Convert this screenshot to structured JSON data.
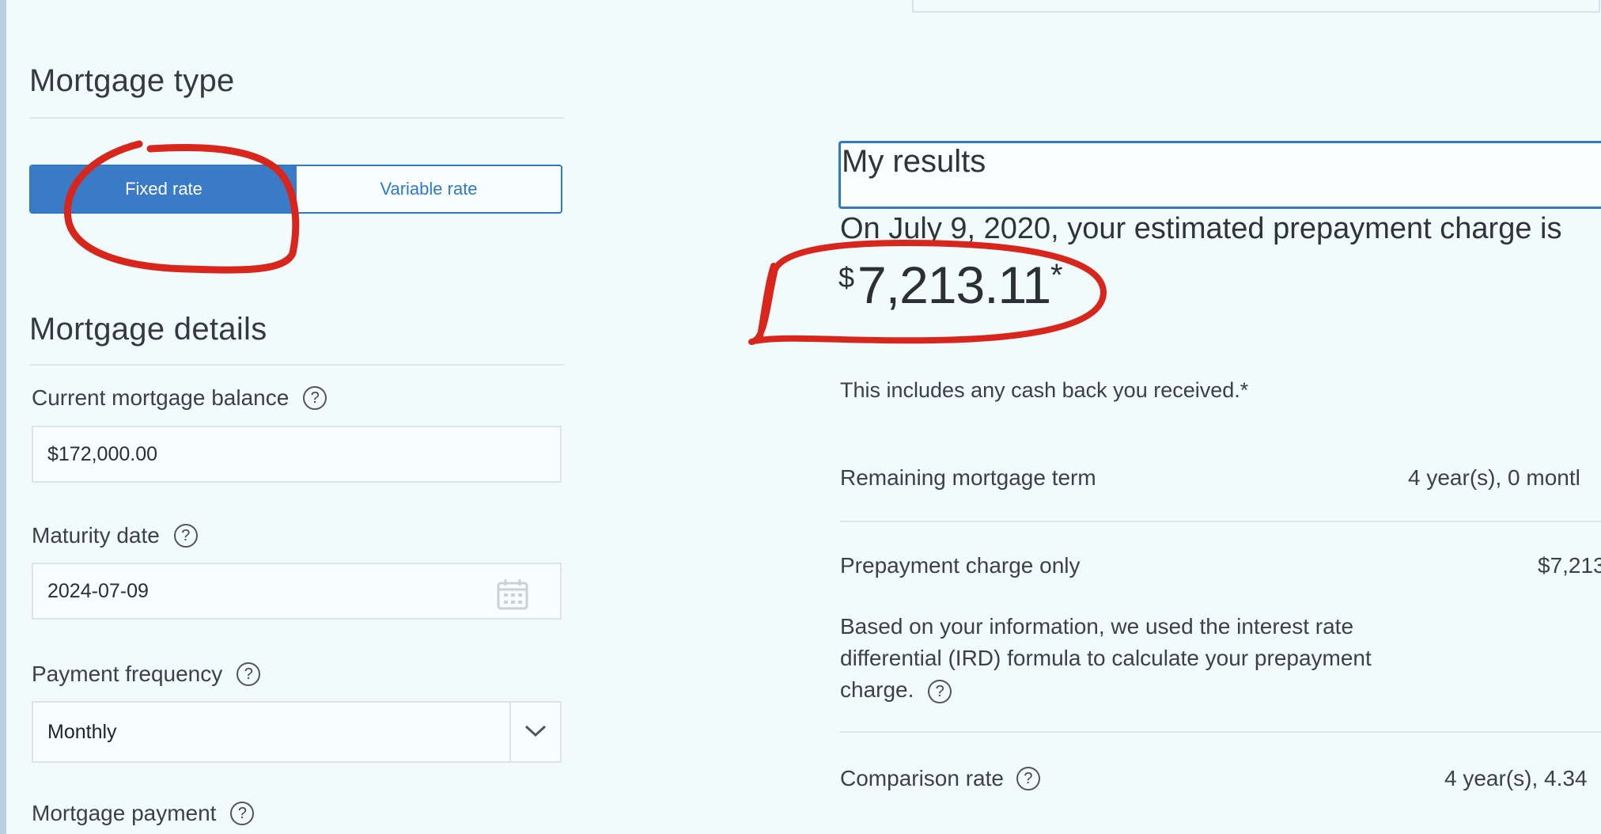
{
  "left": {
    "mortgage_type": {
      "heading": "Mortgage type",
      "options": [
        "Fixed rate",
        "Variable rate"
      ],
      "selected": "Fixed rate"
    },
    "mortgage_details": {
      "heading": "Mortgage details",
      "balance_label": "Current mortgage balance",
      "balance_value": "$172,000.00",
      "maturity_label": "Maturity date",
      "maturity_value": "2024-07-09",
      "frequency_label": "Payment frequency",
      "frequency_value": "Monthly",
      "payment_label": "Mortgage payment",
      "help_glyph": "?"
    }
  },
  "results": {
    "title": "My results",
    "intro": "On July 9, 2020, your estimated prepayment charge is",
    "currency": "$",
    "amount": "7,213.11",
    "asterisk": "*",
    "cashback_note": "This includes any cash back you received.*",
    "rows": {
      "term_label": "Remaining mortgage term",
      "term_value": "4 year(s),  0 montl",
      "charge_label": "Prepayment charge only",
      "charge_value": "$7,213",
      "charge_desc": "Based on your information, we used the interest rate differential (IRD) formula to calculate your prepayment charge.",
      "comparison_label": "Comparison rate",
      "comparison_value": "4 year(s), 4.34"
    }
  },
  "colors": {
    "accent": "#2f79c5",
    "selected_fill": "#3a7bc8",
    "annotation_marker": "#d8261c",
    "background": "#f1fbfc"
  },
  "icons": [
    "help-icon",
    "calendar-icon",
    "chevron-down-icon"
  ]
}
